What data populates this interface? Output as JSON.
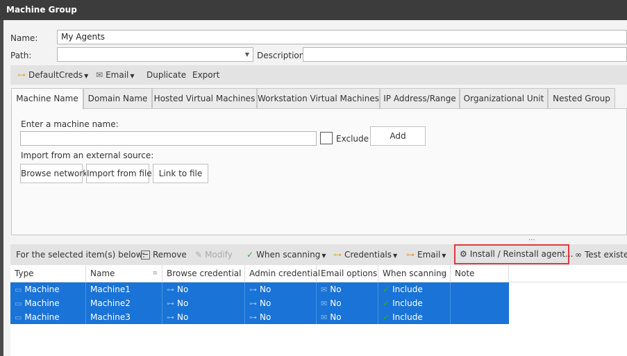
{
  "window": {
    "title": "Machine Group"
  },
  "form": {
    "name_label": "Name:",
    "name_value": "My Agents",
    "path_label": "Path:",
    "path_value": "",
    "description_label": "Description:",
    "description_value": ""
  },
  "toolbar": {
    "default_creds": "DefaultCreds",
    "email": "Email",
    "duplicate": "Duplicate",
    "export": "Export"
  },
  "tabs": [
    "Machine Name",
    "Domain Name",
    "Hosted Virtual Machines",
    "Workstation Virtual Machines",
    "IP Address/Range",
    "Organizational Unit",
    "Nested Group"
  ],
  "machine_tab": {
    "enter_label": "Enter a machine name:",
    "input_value": "",
    "exclude_label": "Exclude",
    "add_label": "Add",
    "import_label": "Import from an external source:",
    "browse_network": "Browse network",
    "import_file": "Import from file",
    "link_file": "Link to file"
  },
  "selection_toolbar": {
    "label": "For the selected item(s) below:",
    "remove": "Remove",
    "modify": "Modify",
    "when_scanning": "When scanning",
    "credentials": "Credentials",
    "email": "Email",
    "install": "Install / Reinstall agent...",
    "test": "Test existe"
  },
  "grid": {
    "columns": [
      "Type",
      "Name",
      "Browse credential",
      "Admin credential",
      "Email options",
      "When scanning",
      "Note"
    ],
    "rows": [
      {
        "type": "Machine",
        "name": "Machine1",
        "browse": "No",
        "admin": "No",
        "email": "No",
        "scan": "Include"
      },
      {
        "type": "Machine",
        "name": "Machine2",
        "browse": "No",
        "admin": "No",
        "email": "No",
        "scan": "Include"
      },
      {
        "type": "Machine",
        "name": "Machine3",
        "browse": "No",
        "admin": "No",
        "email": "No",
        "scan": "Include"
      }
    ]
  },
  "colors": {
    "selection": "#1a73d6",
    "highlight_border": "#e0393e",
    "title_bar": "#3c3c3c"
  },
  "splitter_dots": "..."
}
